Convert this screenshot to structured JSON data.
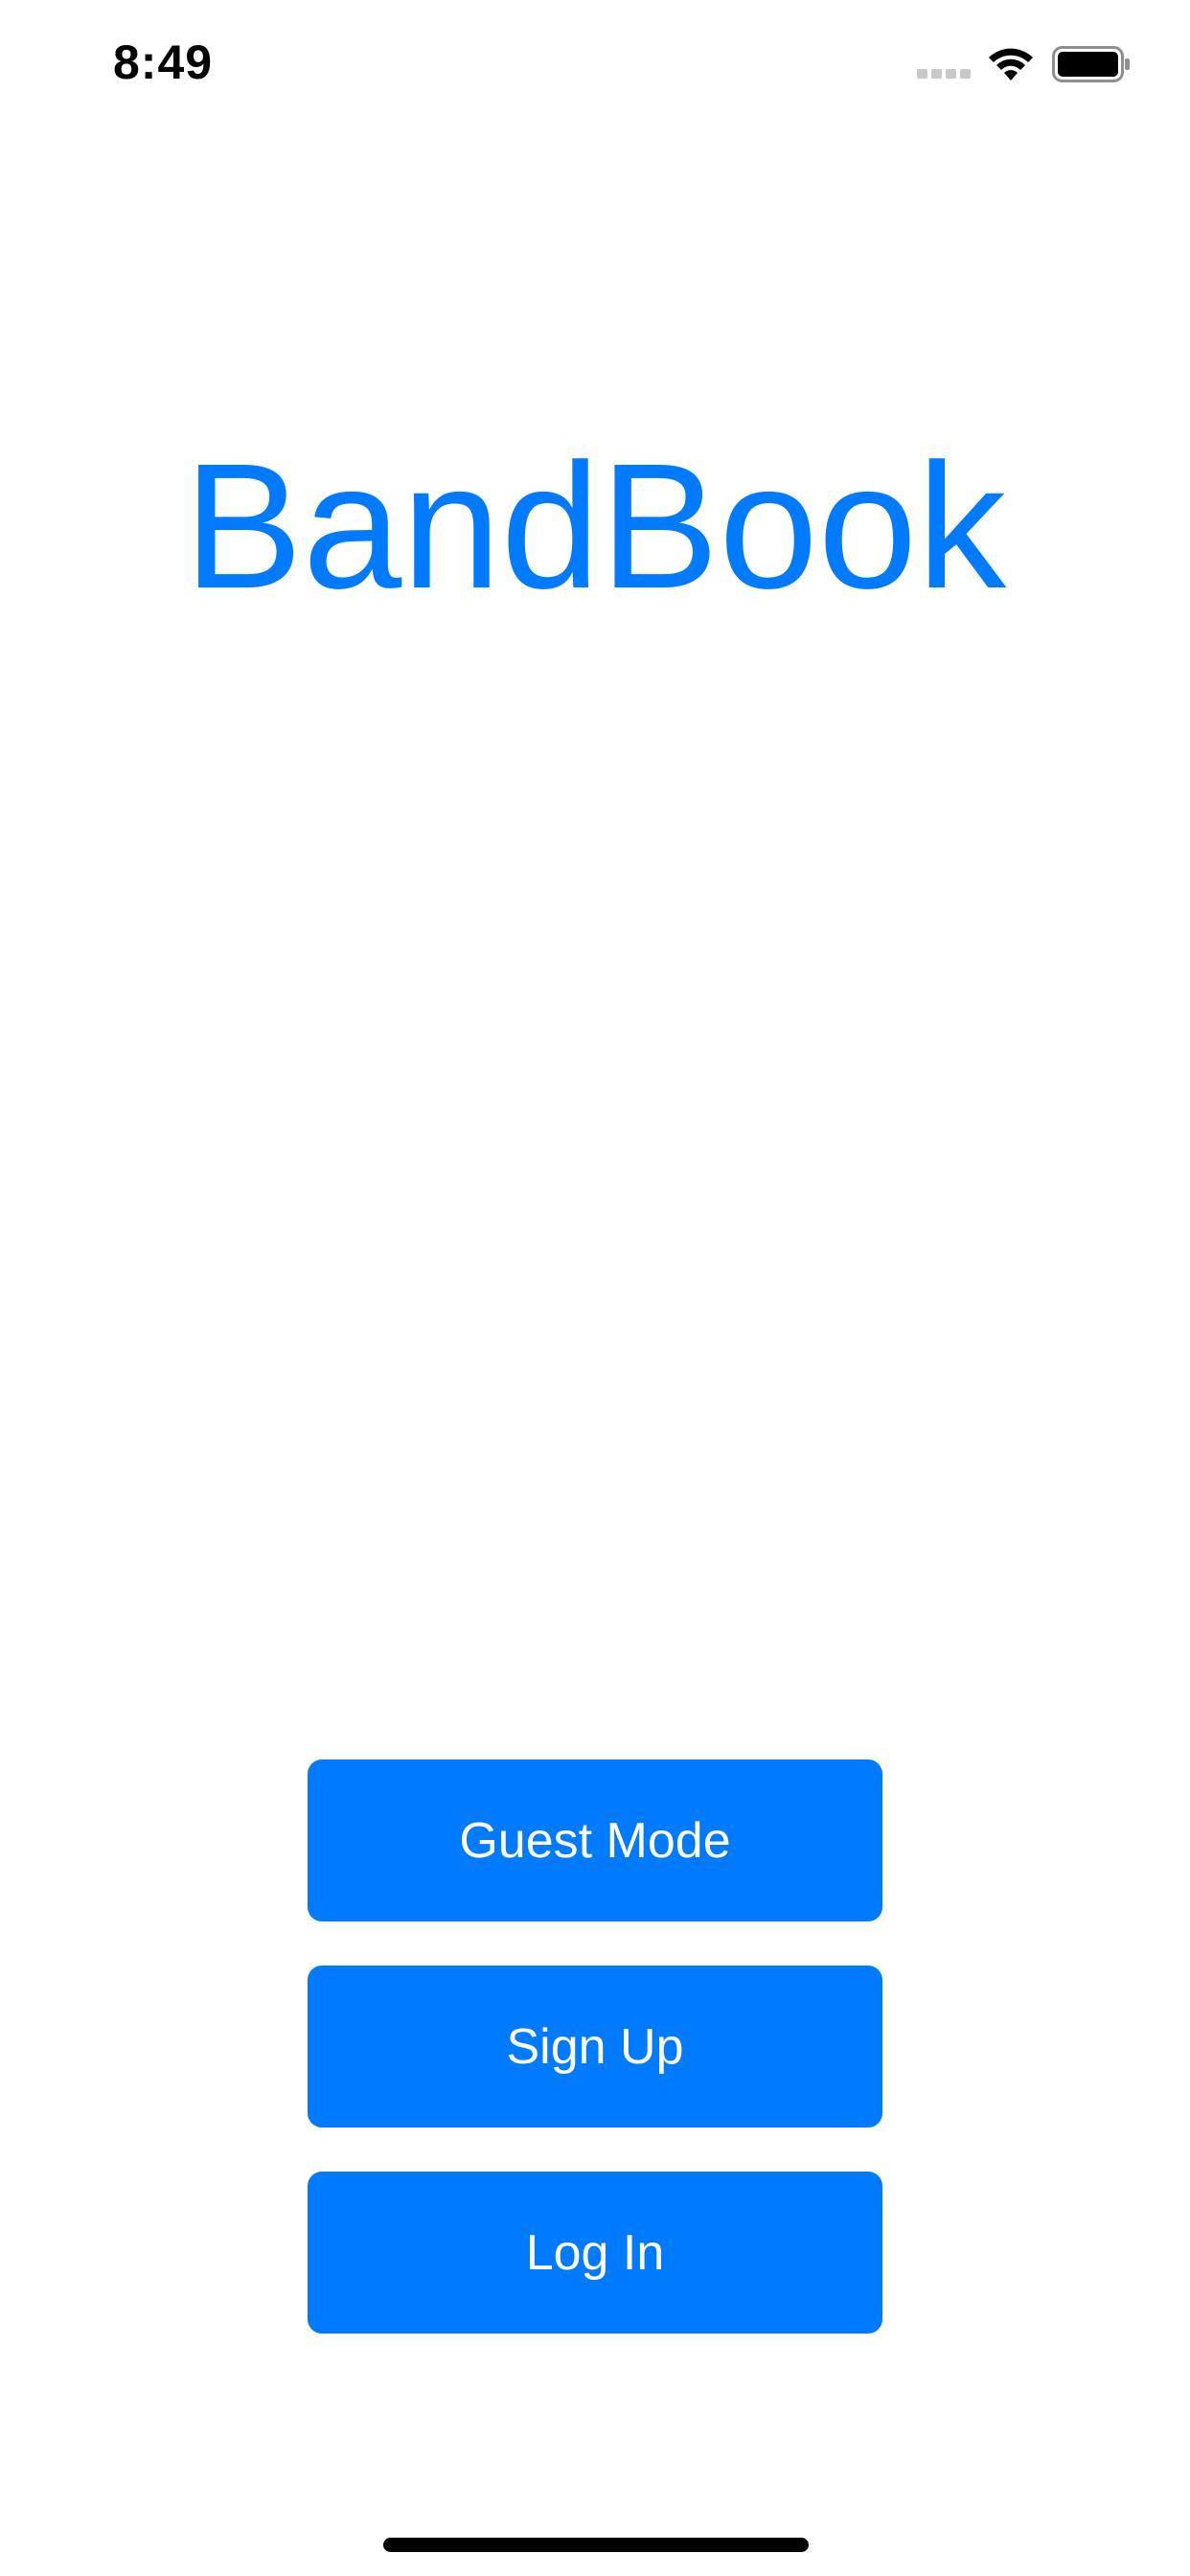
{
  "status_bar": {
    "time": "8:49",
    "icons": [
      "signal-icon",
      "wifi-icon",
      "battery-icon"
    ]
  },
  "app": {
    "title": "BandBook"
  },
  "buttons": {
    "guest_label": "Guest Mode",
    "signup_label": "Sign Up",
    "login_label": "Log In"
  },
  "colors": {
    "accent": "#007aff",
    "background": "#ffffff",
    "text_on_accent": "#ffffff"
  }
}
